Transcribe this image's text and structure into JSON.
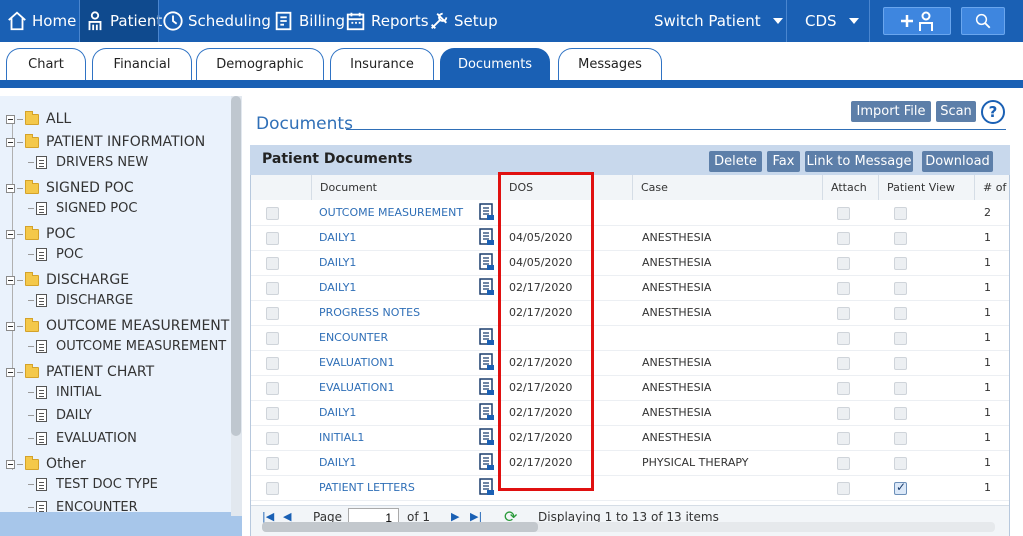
{
  "nav": {
    "home": "Home",
    "patient": "Patient",
    "scheduling": "Scheduling",
    "billing": "Billing",
    "reports": "Reports",
    "setup": "Setup",
    "switch_patient": "Switch Patient",
    "cds": "CDS"
  },
  "tabs": [
    {
      "label": "Chart"
    },
    {
      "label": "Financial"
    },
    {
      "label": "Demographic"
    },
    {
      "label": "Insurance"
    },
    {
      "label": "Documents"
    },
    {
      "label": "Messages"
    }
  ],
  "tree": {
    "all": "ALL",
    "groups": [
      {
        "label": "PATIENT INFORMATION",
        "children": [
          "DRIVERS NEW"
        ]
      },
      {
        "label": "SIGNED POC",
        "children": [
          "SIGNED POC"
        ]
      },
      {
        "label": "POC",
        "children": [
          "POC"
        ]
      },
      {
        "label": "DISCHARGE",
        "children": [
          "DISCHARGE"
        ]
      },
      {
        "label": "OUTCOME MEASUREMENT",
        "children": [
          "OUTCOME MEASUREMENT"
        ]
      },
      {
        "label": "PATIENT CHART",
        "children": [
          "INITIAL",
          "DAILY",
          "EVALUATION"
        ]
      },
      {
        "label": "Other",
        "children": [
          "TEST DOC TYPE",
          "ENCOUNTER"
        ]
      }
    ]
  },
  "page_title": "Documents",
  "top_buttons": {
    "import": "Import File",
    "scan": "Scan",
    "help": "?"
  },
  "panel": {
    "title": "Patient Documents",
    "buttons": {
      "delete": "Delete",
      "fax": "Fax",
      "link": "Link to Message",
      "download": "Download"
    }
  },
  "columns": {
    "document": "Document",
    "dos": "DOS",
    "case": "Case",
    "attach": "Attach",
    "patient_view": "Patient View",
    "count": "# of"
  },
  "rows": [
    {
      "document": "OUTCOME MEASUREMENT",
      "has_icon": true,
      "dos": "",
      "case": "",
      "patient_view": false,
      "count": "2"
    },
    {
      "document": "DAILY1",
      "has_icon": true,
      "dos": "04/05/2020",
      "case": "ANESTHESIA",
      "patient_view": false,
      "count": "1"
    },
    {
      "document": "DAILY1",
      "has_icon": true,
      "dos": "04/05/2020",
      "case": "ANESTHESIA",
      "patient_view": false,
      "count": "1"
    },
    {
      "document": "DAILY1",
      "has_icon": true,
      "dos": "02/17/2020",
      "case": "ANESTHESIA",
      "patient_view": false,
      "count": "1"
    },
    {
      "document": "PROGRESS NOTES",
      "has_icon": false,
      "dos": "02/17/2020",
      "case": "ANESTHESIA",
      "patient_view": false,
      "count": "1"
    },
    {
      "document": "ENCOUNTER",
      "has_icon": true,
      "dos": "",
      "case": "",
      "patient_view": false,
      "count": "1"
    },
    {
      "document": "EVALUATION1",
      "has_icon": true,
      "dos": "02/17/2020",
      "case": "ANESTHESIA",
      "patient_view": false,
      "count": "1"
    },
    {
      "document": "EVALUATION1",
      "has_icon": true,
      "dos": "02/17/2020",
      "case": "ANESTHESIA",
      "patient_view": false,
      "count": "1"
    },
    {
      "document": "DAILY1",
      "has_icon": true,
      "dos": "02/17/2020",
      "case": "ANESTHESIA",
      "patient_view": false,
      "count": "1"
    },
    {
      "document": "INITIAL1",
      "has_icon": true,
      "dos": "02/17/2020",
      "case": "ANESTHESIA",
      "patient_view": false,
      "count": "1"
    },
    {
      "document": "DAILY1",
      "has_icon": true,
      "dos": "02/17/2020",
      "case": "PHYSICAL THERAPY",
      "patient_view": false,
      "count": "1"
    },
    {
      "document": "PATIENT LETTERS",
      "has_icon": true,
      "dos": "",
      "case": "",
      "patient_view": true,
      "count": "1"
    }
  ],
  "pager": {
    "page_label": "Page",
    "page_value": "1",
    "of_label": "of 1",
    "status": "Displaying 1 to 13 of 13 items"
  },
  "colors": {
    "brand": "#1a60b4",
    "highlight": "#e01010",
    "link": "#2f6fb7"
  }
}
